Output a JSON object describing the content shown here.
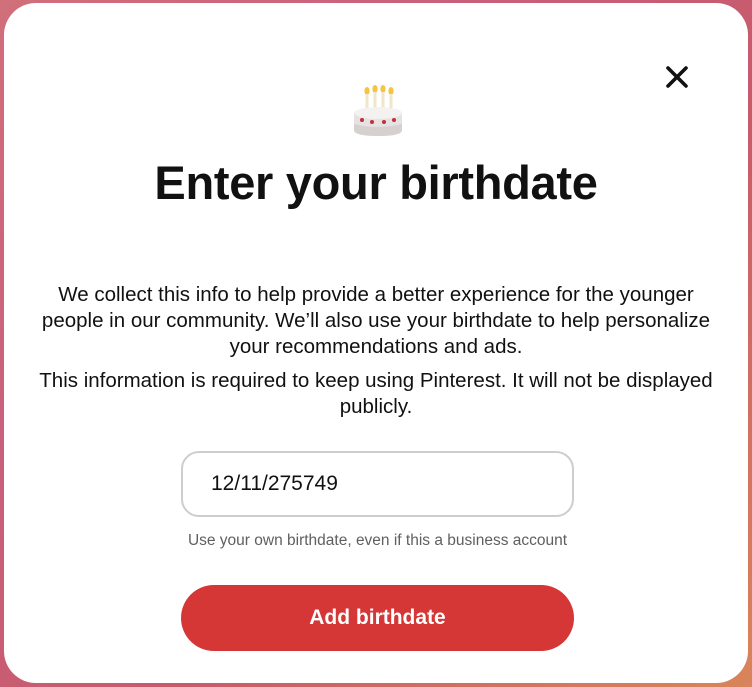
{
  "modal": {
    "title": "Enter your birthdate",
    "description": "We collect this info to help provide a better experience for the younger people in our community. We’ll also use your birthdate to help personalize your recommendations and ads.",
    "requirement_note": "This information is required to keep using Pinterest. It will not be displayed publicly.",
    "close_icon": "close-icon",
    "cake_icon": "birthday-cake-icon"
  },
  "birthdate_field": {
    "value": "12/11/275749",
    "placeholder": ""
  },
  "hint_text": "Use your own birthdate, even if this a business account",
  "submit_button": {
    "label": "Add birthdate"
  },
  "colors": {
    "accent": "#d53636",
    "text": "#111111",
    "hint": "#5f5f5f",
    "input_border": "#cdcdcd"
  }
}
